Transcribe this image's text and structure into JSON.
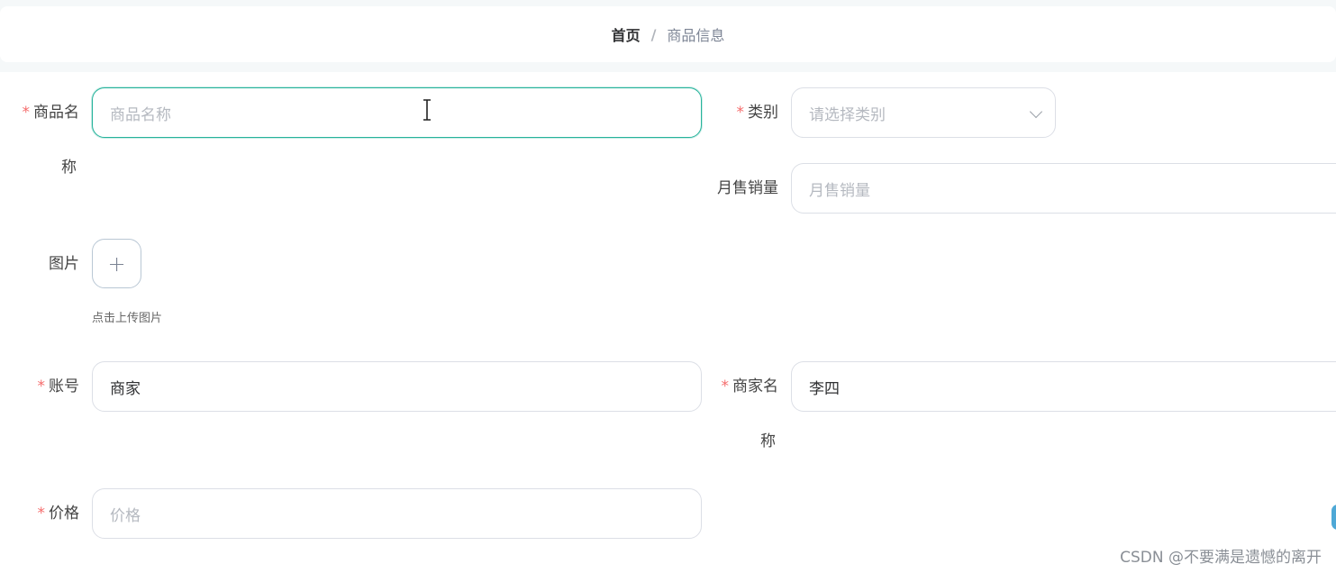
{
  "breadcrumb": {
    "home": "首页",
    "separator": "/",
    "current": "商品信息"
  },
  "form": {
    "name": {
      "required": "*",
      "label_line1": "商品名",
      "label_line2": "称",
      "placeholder": "商品名称"
    },
    "category": {
      "required": "*",
      "label": "类别",
      "placeholder": "请选择类别"
    },
    "monthly_sales": {
      "label": "月售销量",
      "placeholder": "月售销量"
    },
    "image": {
      "label": "图片",
      "upload_symbol": "+",
      "hint": "点击上传图片"
    },
    "account": {
      "required": "*",
      "label": "账号",
      "value": "商家"
    },
    "merchant_name": {
      "required": "*",
      "label_line1": "商家名",
      "label_line2": "称",
      "value": "李四"
    },
    "price": {
      "required": "*",
      "label": "价格",
      "placeholder": "价格"
    }
  },
  "watermark": "CSDN @不要满是遗憾的离开",
  "colors": {
    "accent": "#26b39b",
    "required": "#f56c6c",
    "border": "#dcdfe6"
  }
}
